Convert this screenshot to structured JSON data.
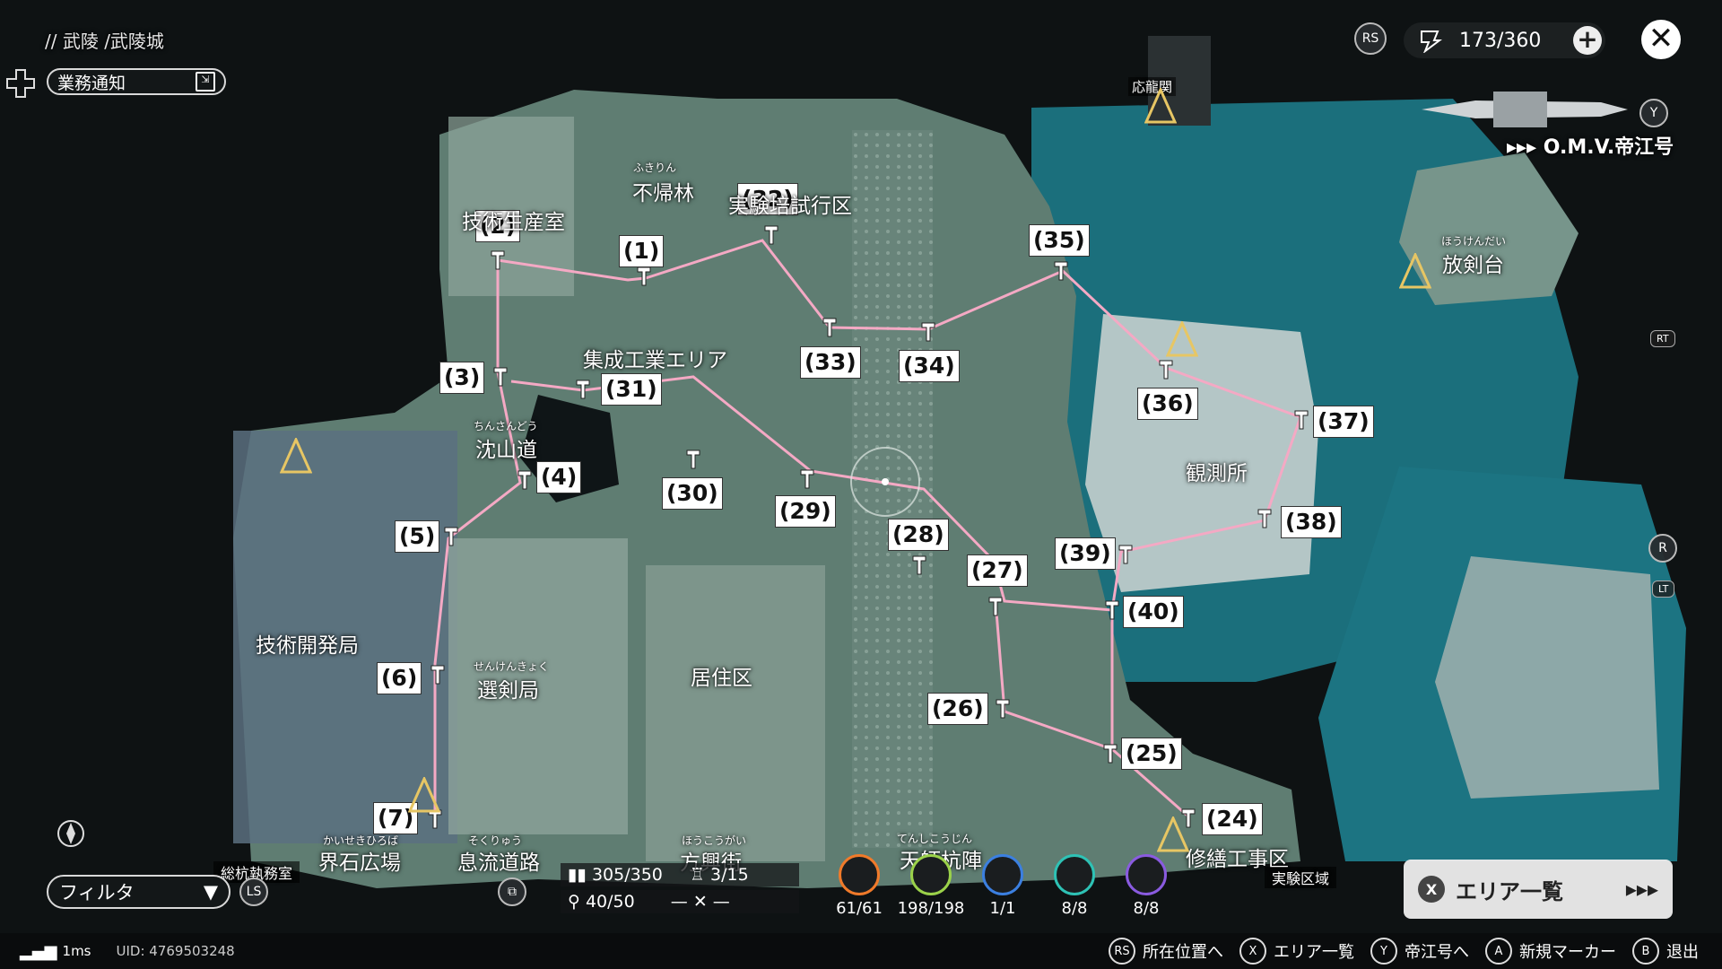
{
  "breadcrumb": "// 武陵 /武陵城",
  "notice_label": "業務通知",
  "currency_value": "173/360",
  "ship_name": "O.M.V.帝江号",
  "side_tags": {
    "rs": "RS",
    "rt": "RT",
    "r": "R",
    "lt": "LT",
    "ls": "LS",
    "y": "Y"
  },
  "areas": {
    "fukirin": "不帰林",
    "fukirin_ruby": "ふきりん",
    "gijutsu_seisan": "技術生産室",
    "baishi": "実験培試行区",
    "shusei": "集成工業エリア",
    "chinsando": "沈山道",
    "chinsando_ruby": "ちんさんどう",
    "gijutsu_kaihatsu": "技術開発局",
    "senken": "選剣局",
    "senken_ruby": "せんけんきょく",
    "kyojuku": "居住区",
    "kansoku": "観測所",
    "houken": "放剣台",
    "houken_ruby": "ほうけんだい",
    "ouryu": "応龍関",
    "kaiseki": "界石広場",
    "kaiseki_ruby": "かいせきひろば",
    "sokuryu": "息流道路",
    "sokuryu_ruby": "そくりゅう",
    "houko": "方興街",
    "houko_ruby": "ほうこうがい",
    "tenshi": "天師杭陣",
    "tenshi_ruby": "てんしこうじん",
    "shuzen": "修繕工事区",
    "jikken": "実験区域",
    "soko": "総杭執務室"
  },
  "markers": [
    {
      "label": "(1)"
    },
    {
      "label": "(2)"
    },
    {
      "label": "(3)"
    },
    {
      "label": "(4)"
    },
    {
      "label": "(5)"
    },
    {
      "label": "(6)"
    },
    {
      "label": "(7)"
    },
    {
      "label": "(24)"
    },
    {
      "label": "(25)"
    },
    {
      "label": "(26)"
    },
    {
      "label": "(27)"
    },
    {
      "label": "(28)"
    },
    {
      "label": "(29)"
    },
    {
      "label": "(30)"
    },
    {
      "label": "(31)"
    },
    {
      "label": "(32)"
    },
    {
      "label": "(33)"
    },
    {
      "label": "(34)"
    },
    {
      "label": "(35)"
    },
    {
      "label": "(36)"
    },
    {
      "label": "(37)"
    },
    {
      "label": "(38)"
    },
    {
      "label": "(39)"
    },
    {
      "label": "(40)"
    }
  ],
  "filter_label": "フィルタ",
  "stats": {
    "a": "305/350",
    "b": "3/15",
    "c": "40/50"
  },
  "categories": [
    {
      "count": "61/61",
      "color": "#f07a2a"
    },
    {
      "count": "198/198",
      "color": "#9bd24a"
    },
    {
      "count": "1/1",
      "color": "#3b7fe0"
    },
    {
      "count": "8/8",
      "color": "#2ec2b5"
    },
    {
      "count": "8/8",
      "color": "#8a5be0"
    }
  ],
  "area_list": {
    "key": "X",
    "label": "エリア一覧"
  },
  "status": {
    "ping": "1ms",
    "uid": "UID: 4769503248"
  },
  "hints": [
    {
      "key": "RS",
      "label": "所在位置へ"
    },
    {
      "key": "X",
      "label": "エリア一覧"
    },
    {
      "key": "Y",
      "label": "帝江号へ"
    },
    {
      "key": "A",
      "label": "新規マーカー"
    },
    {
      "key": "B",
      "label": "退出"
    }
  ]
}
